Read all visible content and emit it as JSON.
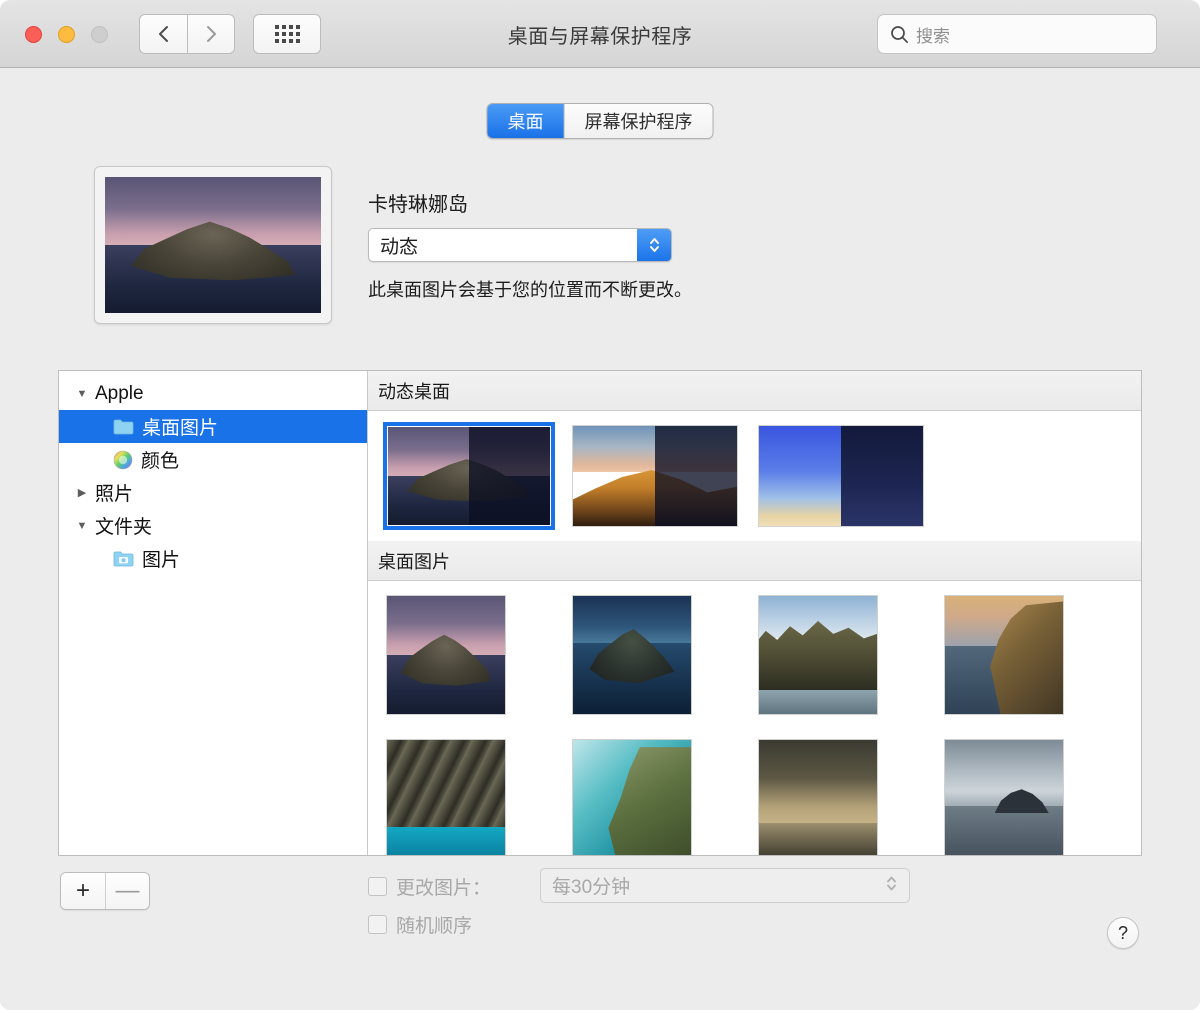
{
  "window": {
    "title": "桌面与屏幕保护程序",
    "traffic_lights": [
      "close",
      "minimize",
      "zoom"
    ],
    "nav": {
      "back": "back-arrow",
      "forward": "forward-arrow",
      "show_all": "grid-icon"
    }
  },
  "search": {
    "placeholder": "搜索",
    "icon": "search-icon"
  },
  "tabs": [
    {
      "label": "桌面",
      "active": true
    },
    {
      "label": "屏幕保护程序",
      "active": false
    }
  ],
  "preview": {
    "current_name": "卡特琳娜岛",
    "popup_value": "动态",
    "popup_icon": "stepper-arrows-icon",
    "description": "此桌面图片会基于您的位置而不断更改。",
    "thumbnail_art": "cat-dusk"
  },
  "sidebar": {
    "items": [
      {
        "label": "Apple",
        "disclosure": "▼",
        "level": 0,
        "icon": null,
        "selected": false
      },
      {
        "label": "桌面图片",
        "disclosure": "",
        "level": 1,
        "icon": "folder-icon",
        "selected": true
      },
      {
        "label": "颜色",
        "disclosure": "",
        "level": 1,
        "icon": "color-wheel-icon",
        "selected": false
      },
      {
        "label": "照片",
        "disclosure": "▶",
        "level": 0,
        "icon": null,
        "selected": false
      },
      {
        "label": "文件夹",
        "disclosure": "▼",
        "level": 0,
        "icon": null,
        "selected": false
      },
      {
        "label": "图片",
        "disclosure": "",
        "level": 1,
        "icon": "pictures-folder-icon",
        "selected": false
      }
    ]
  },
  "gallery": {
    "sections": [
      {
        "title": "动态桌面",
        "layout": "wide",
        "items": [
          {
            "art": "cat-dusk",
            "split": true,
            "selected": true
          },
          {
            "art": "mojave",
            "split": true,
            "selected": false
          },
          {
            "art": "solar",
            "split": true,
            "selected": false
          }
        ]
      },
      {
        "title": "桌面图片",
        "layout": "square",
        "rows": [
          [
            {
              "art": "cat-dusk",
              "selected": false
            },
            {
              "art": "cat-blue",
              "selected": false
            },
            {
              "art": "cat-day",
              "selected": false
            },
            {
              "art": "cat-gold",
              "selected": false
            }
          ],
          [
            {
              "art": "rock",
              "selected": false
            },
            {
              "art": "coast",
              "selected": false
            },
            {
              "art": "storm",
              "selected": false
            },
            {
              "art": "cloudy",
              "selected": false
            }
          ]
        ]
      }
    ]
  },
  "bottom": {
    "add_label": "+",
    "remove_label": "—",
    "change_picture_label": "更改图片：",
    "change_picture_checked": false,
    "interval_value": "每30分钟",
    "random_order_label": "随机顺序",
    "random_order_checked": false,
    "help_label": "?"
  },
  "colors": {
    "accent": "#1a72e8",
    "selection": "#1a72e8",
    "window_bg": "#ececec",
    "panel_bg": "#ffffff",
    "disabled_text": "#a8a8a8"
  }
}
